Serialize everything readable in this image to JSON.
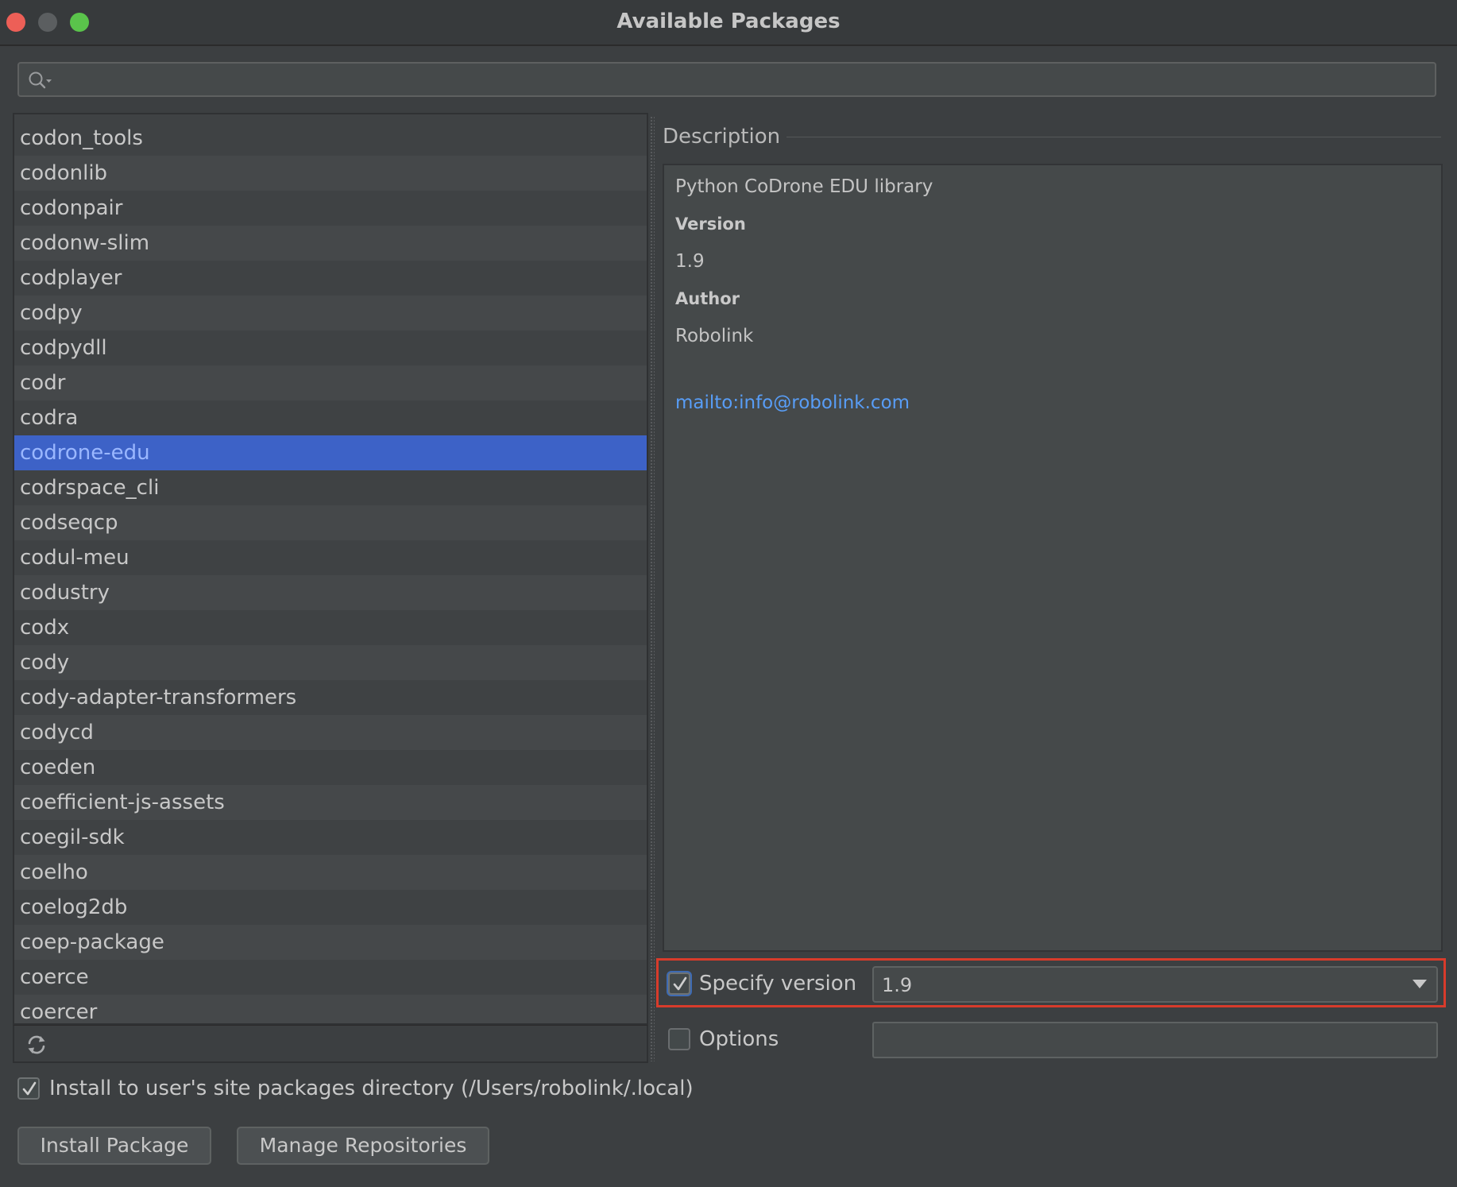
{
  "window": {
    "title": "Available Packages"
  },
  "search": {
    "value": "",
    "placeholder": ""
  },
  "packages": {
    "items": [
      "codon_tools",
      "codonlib",
      "codonpair",
      "codonw-slim",
      "codplayer",
      "codpy",
      "codpydll",
      "codr",
      "codra",
      "codrone-edu",
      "codrspace_cli",
      "codseqcp",
      "codul-meu",
      "codustry",
      "codx",
      "cody",
      "cody-adapter-transformers",
      "codycd",
      "coeden",
      "coefficient-js-assets",
      "coegil-sdk",
      "coelho",
      "coelog2db",
      "coep-package",
      "coerce",
      "coercer"
    ],
    "selected": "codrone-edu"
  },
  "description": {
    "heading": "Description",
    "summary": "Python CoDrone EDU library",
    "version_label": "Version",
    "version_value": "1.9",
    "author_label": "Author",
    "author_value": "Robolink",
    "link": "mailto:info@robolink.com"
  },
  "specify_version": {
    "label": "Specify version",
    "checked": true,
    "value": "1.9"
  },
  "options": {
    "label": "Options",
    "checked": false,
    "value": ""
  },
  "install_user_site": {
    "label": "Install to user's site packages directory (/Users/robolink/.local)",
    "checked": true
  },
  "buttons": {
    "install": "Install Package",
    "manage": "Manage Repositories"
  },
  "icons": {
    "search": "search-icon",
    "refresh": "refresh-icon",
    "dropdown": "chevron-down-icon",
    "check": "check-icon"
  },
  "colors": {
    "selection": "#3d62c7",
    "selection_text": "#9ab7ff",
    "link": "#589df6",
    "highlight_border": "#d83b2b",
    "traffic_close": "#ed5f57",
    "traffic_min": "#5b5e60",
    "traffic_max": "#5ac34b"
  }
}
